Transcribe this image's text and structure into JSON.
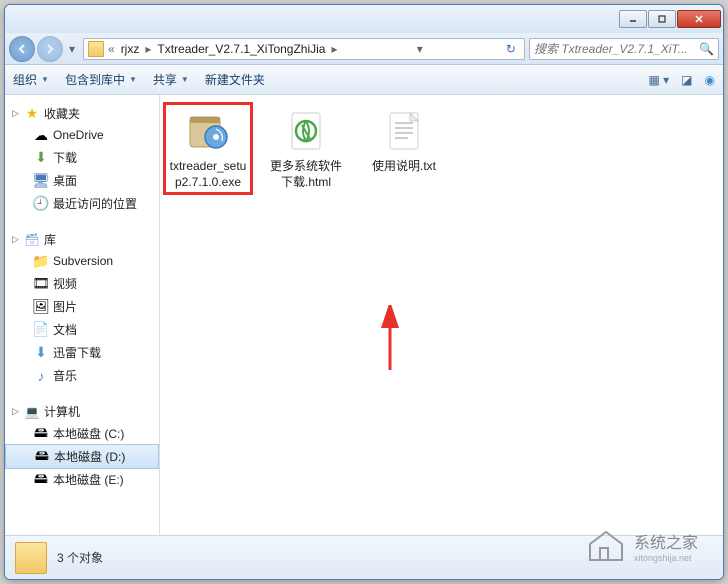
{
  "breadcrumb": {
    "prefix": "«",
    "items": [
      "rjxz",
      "Txtreader_V2.7.1_XiTongZhiJia"
    ]
  },
  "search": {
    "placeholder": "搜索 Txtreader_V2.7.1_XiT..."
  },
  "toolbar": {
    "organize": "组织",
    "include": "包含到库中",
    "share": "共享",
    "newfolder": "新建文件夹"
  },
  "sidebar": {
    "favorites": {
      "label": "收藏夹",
      "items": [
        {
          "icon": "cloud",
          "label": "OneDrive"
        },
        {
          "icon": "download",
          "label": "下载"
        },
        {
          "icon": "desktop",
          "label": "桌面"
        },
        {
          "icon": "recent",
          "label": "最近访问的位置"
        }
      ]
    },
    "libraries": {
      "label": "库",
      "items": [
        {
          "icon": "svn",
          "label": "Subversion"
        },
        {
          "icon": "video",
          "label": "视频"
        },
        {
          "icon": "pictures",
          "label": "图片"
        },
        {
          "icon": "documents",
          "label": "文档"
        },
        {
          "icon": "thunder",
          "label": "迅雷下载"
        },
        {
          "icon": "music",
          "label": "音乐"
        }
      ]
    },
    "computer": {
      "label": "计算机",
      "items": [
        {
          "icon": "drive",
          "label": "本地磁盘 (C:)"
        },
        {
          "icon": "drive",
          "label": "本地磁盘 (D:)",
          "selected": true
        },
        {
          "icon": "drive",
          "label": "本地磁盘 (E:)"
        }
      ]
    }
  },
  "files": [
    {
      "name": "txtreader_setup2.7.1.0.exe",
      "type": "installer",
      "highlight": true
    },
    {
      "name": "更多系统软件下载.html",
      "type": "html"
    },
    {
      "name": "使用说明.txt",
      "type": "txt"
    }
  ],
  "statusbar": {
    "text": "3 个对象"
  },
  "watermark": {
    "text": "系统之家",
    "sub": "xitongshija.net"
  }
}
